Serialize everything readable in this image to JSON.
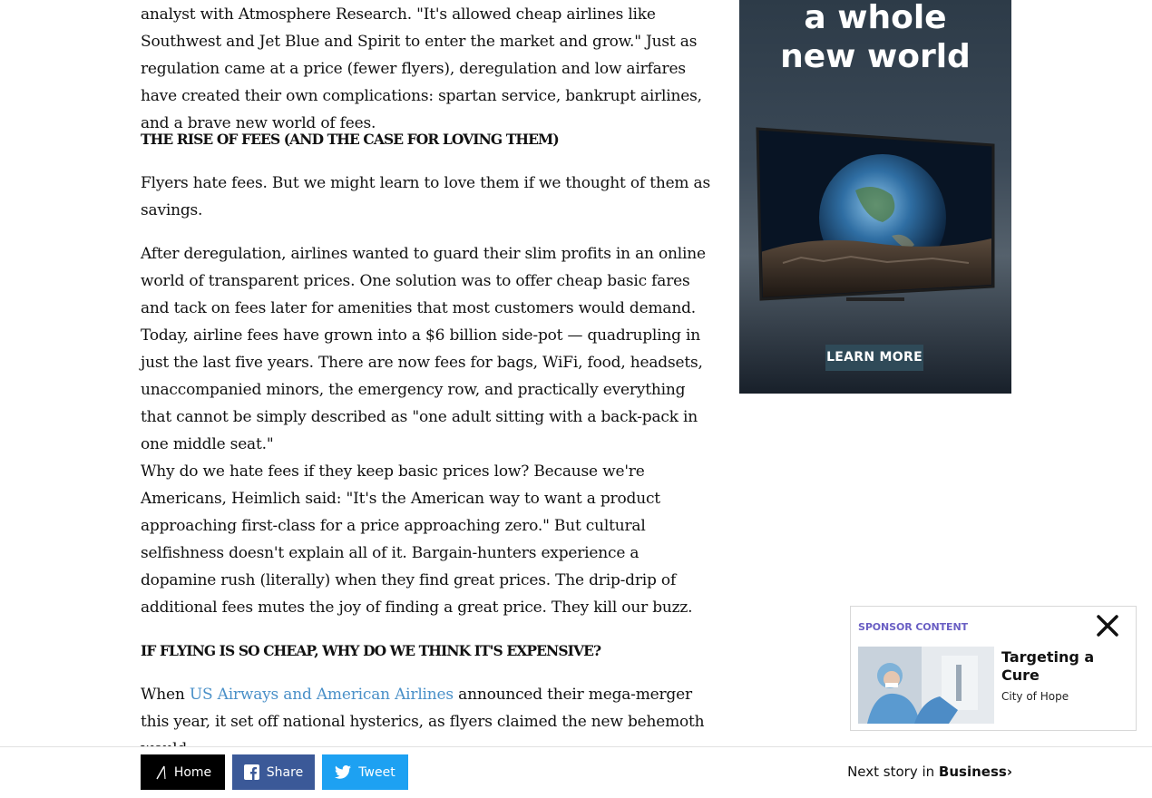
{
  "article": {
    "p1": "analyst with Atmosphere Research. \"It's allowed cheap airlines like Southwest and Jet Blue and Spirit to enter the market and grow.\" Just as regulation came at a price (fewer flyers), deregulation and low airfares have created their own complications: spartan service, bankrupt airlines, and a brave new world of fees.",
    "h1": "The Rise of Fees (and the Case for Loving Them)",
    "p2": "Flyers hate fees. But we might learn to love them if we thought of them as savings.",
    "p3": "After deregulation, airlines wanted to guard their slim profits in an online world of transparent prices. One solution was to offer cheap basic fares and tack on fees later for amenities that most customers would demand. Today, airline fees have grown into a $6 billion side-pot — quadrupling in just the last five years. There are now fees for bags, WiFi, food, headsets, unaccompanied minors, the emergency row, and practically everything that cannot be simply described as \"one adult sitting with a back-pack in one middle seat.\"",
    "p4": "Why do we hate fees if they keep basic prices low? Because we're Americans, Heimlich said: \"It's the American way to want a product approaching first-class for a price approaching zero.\" But cultural selfishness doesn't explain all of it. Bargain-hunters experience a dopamine rush (literally) when they find great prices. The drip-drip of additional fees mutes the joy of finding a great price. They kill our buzz.",
    "h2": "If Flying Is So Cheap, Why Do We Think It's Expensive?",
    "p5_before": "When ",
    "p5_link": "US Airways and American Airlines",
    "p5_after": " announced their mega-merger this year, it set off national hysterics, as flyers claimed the new behemoth would"
  },
  "ad": {
    "headline": "a whole\nnew world",
    "learn_more": "LEARN MORE"
  },
  "sponsor": {
    "label": "SPONSOR CONTENT",
    "title": "Targeting a Cure",
    "source": "City of Hope"
  },
  "bottombar": {
    "home": "Home",
    "share": "Share",
    "tweet": "Tweet",
    "next_prefix": "Next story in ",
    "next_section": "Business",
    "next_chevron": "›"
  },
  "colors": {
    "link": "#4a90c8",
    "sponsor_label": "#6a5fc4",
    "facebook": "#3b5998",
    "twitter": "#1da1f2"
  }
}
